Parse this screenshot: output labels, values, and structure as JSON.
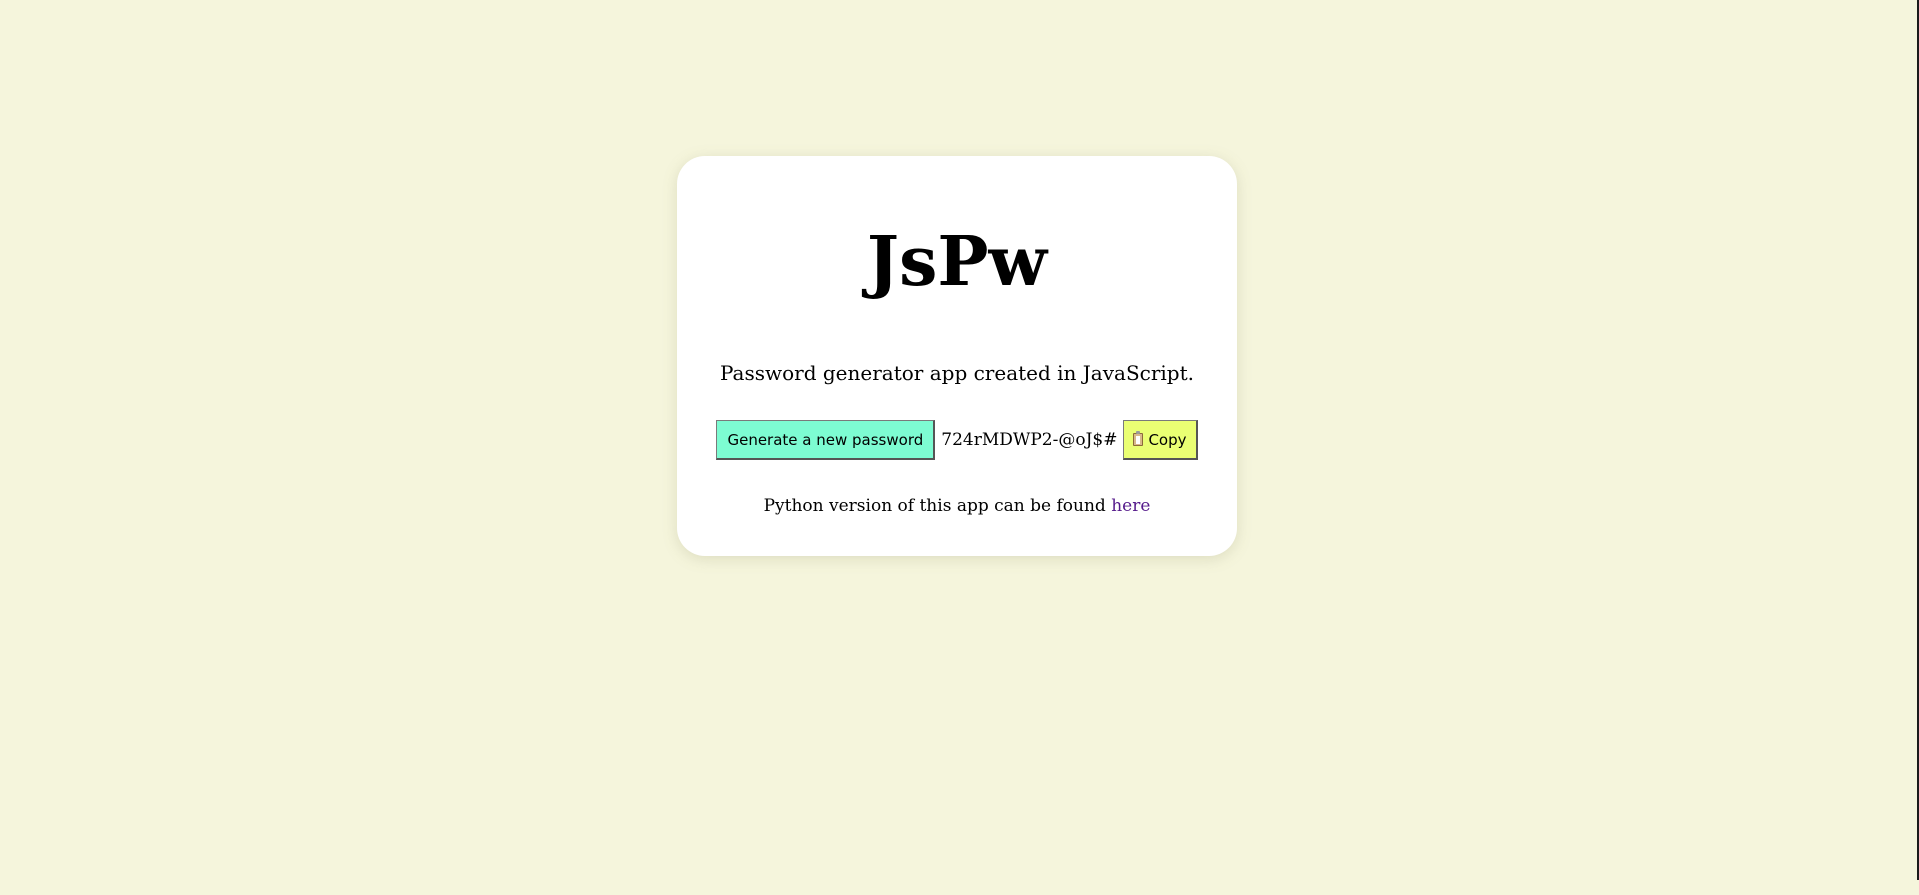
{
  "app": {
    "title": "JsPw",
    "subtitle": "Password generator app created in JavaScript.",
    "generate_button_label": "Generate a new password",
    "password": "724rMDWP2-@oJ$#",
    "copy_button_label": "Copy",
    "copy_icon": "clipboard-icon",
    "footer_text": "Python version of this app can be found ",
    "footer_link_label": "here"
  },
  "colors": {
    "page_background": "#f5f5dc",
    "card_background": "#ffffff",
    "generate_button": "#7dfcd2",
    "copy_button": "#eaff73",
    "visited_link": "#551a8b"
  }
}
